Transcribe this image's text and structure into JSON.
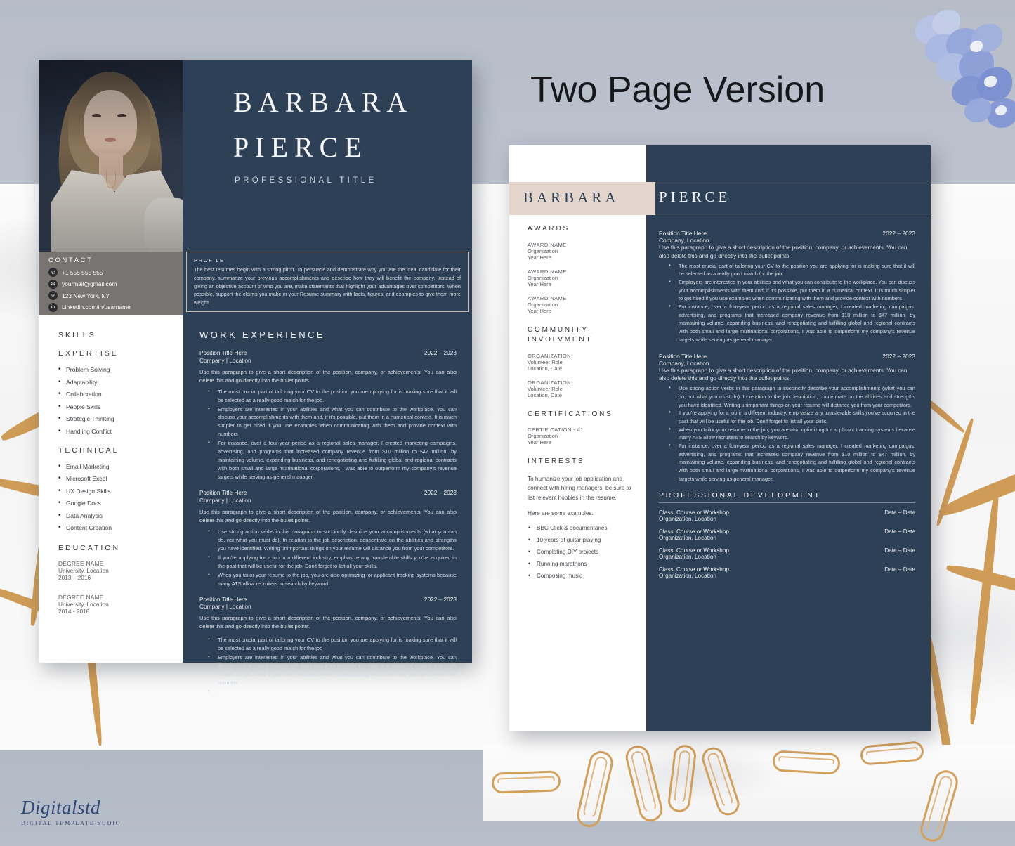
{
  "mockup": {
    "headline": "Two Page Version",
    "brand_name": "Digitalstd",
    "brand_tagline": "DIGITAL TEMPLATE SUDIO",
    "accent_navy": "#2e4055",
    "accent_beige": "#e3d5cb",
    "accent_gold": "#cf9c58"
  },
  "page1": {
    "name_first": "BARBARA",
    "name_last": "PIERCE",
    "professional_title": "PROFESSIONAL TITLE",
    "contact": {
      "heading": "CONTACT",
      "items": [
        {
          "icon": "phone-icon",
          "text": "+1 555 555 555"
        },
        {
          "icon": "envelope-icon",
          "text": "yourmail@gmail.com"
        },
        {
          "icon": "location-pin-icon",
          "text": "123 New York, NY"
        },
        {
          "icon": "linkedin-icon",
          "text": "Linkedin.com/in/usarname"
        }
      ]
    },
    "profile": {
      "heading": "PROFILE",
      "body": "The best resumes begin with a strong pitch. To persuade and demonstrate why you are the ideal candidate for their company, summarize your previous accomplishments and describe how they will benefit the company. Instead of giving an objective account of who you are, make statements that highlight your advantages over competitors. When possible, support the claims you make in your Resume summary with facts, figures, and examples to give them more weight."
    },
    "skills": {
      "heading": "SKILLS",
      "expertise_heading": "EXPERTISE",
      "expertise": [
        "Problem Solving",
        "Adaptability",
        "Collaboration",
        "People Skills",
        "Strategic Thinking",
        "Handling Conflict"
      ],
      "technical_heading": "TECHNICAL",
      "technical": [
        "Email Marketing",
        "Microsoft Excel",
        "UX Design Skills",
        "Google Docs",
        "Data Analysis",
        "Content Creation"
      ]
    },
    "education": {
      "heading": "EDUCATION",
      "entries": [
        {
          "degree": "DEGREE NAME",
          "school": "University, Location",
          "years": "2013 – 2016"
        },
        {
          "degree": "DEGREE NAME",
          "school": "University, Location",
          "years": "2014 - 2018"
        }
      ]
    },
    "work_experience": {
      "heading": "WORK EXPERIENCE",
      "jobs": [
        {
          "title": "Position Title Here",
          "date": "2022 – 2023",
          "company": "Company | Location",
          "description": "Use this paragraph to give a short description of the position, company, or achievements. You can also delete this and go directly into the bullet points.",
          "bullets": [
            "The most crucial part of tailoring your CV to the position you are applying for is making sure that it will be selected as a really good match for the job.",
            "Employers are interested in your abilities and what you can contribute to the workplace. You can discuss your accomplishments with them and, if it's possible, put them in a numerical context. It is much simpler to get hired if you use examples when communicating with them and provide context with numbers",
            "For instance, over a four-year period as a regional sales manager, I created marketing campaigns, advertising, and programs that increased company revenue from $10 million to $47 million. by maintaining volume, expanding business, and renegotiating and fulfilling global and regional contracts with both small and large multinational corporations, I was able to outperform my company's revenue targets while serving as general manager."
          ]
        },
        {
          "title": "Position Title Here",
          "date": "2022 – 2023",
          "company": "Company | Location",
          "description": "Use this paragraph to give a short description of the position, company, or achievements. You can also delete this and go directly into the bullet points.",
          "bullets": [
            "Use strong action verbs in this paragraph to succinctly describe your accomplishments (what you can do, not what you must do). In relation to the job description, concentrate on the abilities and strengths you have identified. Writing unimportant things on your resume will distance you from your competitors.",
            "If you're applying for a job in a different industry, emphasize any transferable skills you've acquired in the past that will be useful for the job. Don't forget to list all your skills.",
            "When you tailor your resume to the job, you are also optimizing for applicant tracking systems because many ATS allow recruiters to search by keyword."
          ]
        },
        {
          "title": "Position Title Here",
          "date": "2022 – 2023",
          "company": "Company | Location",
          "description": "Use this paragraph to give a short description of the position, company, or achievements. You can also delete this and go directly into the bullet points.",
          "bullets": [
            "The most crucial part of tailoring your CV to the position you are applying for is making sure that it will be selected as a really good match for the job",
            "Employers are interested in your abilities and what you can contribute to the workplace. You can discuss your accomplishments with them and, if it's possible, put them in a numerical context. It is much simpler to get hired if you use examples when communicating with them and provide context with numbers",
            "."
          ]
        }
      ]
    }
  },
  "page2": {
    "name_first": "BARBARA",
    "name_last": "PIERCE",
    "awards": {
      "heading": "AWARDS",
      "entries": [
        {
          "name": "AWARD NAME",
          "org": "Organization",
          "year": "Year Here"
        },
        {
          "name": "AWARD NAME",
          "org": "Organization",
          "year": "Year Here"
        },
        {
          "name": "AWARD NAME",
          "org": "Organization",
          "year": "Year Here"
        }
      ]
    },
    "community": {
      "heading": "COMMUNITY INVOLVMENT",
      "entries": [
        {
          "name": "ORGANIZATION",
          "org": "Volunteer Role",
          "year": "Location, Date"
        },
        {
          "name": "ORGANIZATION",
          "org": "Volunteer Role",
          "year": "Location, Date"
        }
      ]
    },
    "certifications": {
      "heading": "CERTIFICATIONS",
      "entries": [
        {
          "name": "CERTIFICATION - #1",
          "org": "Organization",
          "year": "Year Here"
        }
      ]
    },
    "interests": {
      "heading": "INTERESTS",
      "intro": "To humanize your job application and connect with hiring managers, be sure to list relevant hobbies in the resume.",
      "examples_label": "Here are some examples:",
      "items": [
        "BBC Click & documentaries",
        "10 years of guitar playing",
        "Completing DIY projects",
        "Running marathons",
        "Composing music"
      ]
    },
    "jobs": [
      {
        "title": "Position Title Here",
        "date": "2022 – 2023",
        "company": "Company, Location",
        "description": "Use this paragraph to give a short description of the position, company, or achievements. You can also delete this and go directly into the bullet points.",
        "bullets": [
          "The most crucial part of tailoring your CV to the position you are applying for is making sure that it will be selected as a really good match for the job.",
          "Employers are interested in your abilities and what you can contribute to the workplace. You can discuss your accomplishments with them and, if it's possible, put them in a numerical context. It is much simpler to get hired if you use examples when communicating with them and provide context with numbers",
          "For instance, over a four-year period as a regional sales manager, I created marketing campaigns, advertising, and programs that increased company revenue from $10 million to $47 million. by maintaining volume, expanding business, and renegotiating and fulfilling global and regional contracts with both small and large multinational corporations, I was able to outperform my company's revenue targets while serving as general manager."
        ]
      },
      {
        "title": "Position Title Here",
        "date": "2022 – 2023",
        "company": "Company, Location",
        "description": "Use this paragraph to give a short description of the position, company, or achievements. You can also delete this and go directly into the bullet points.",
        "bullets": [
          "Use strong action verbs in this paragraph to succinctly describe your accomplishments (what you can do, not what you must do). In relation to the job description, concentrate on the abilities and strengths you have identified. Writing unimportant things on your resume will distance you from your competitors.",
          "If you're applying for a job in a different industry, emphasize any transferable skills you've acquired in the past that will be useful for the job. Don't forget to list all your skills.",
          "When you tailor your resume to the job, you are also optimizing for applicant tracking systems because many ATS allow recruiters to search by keyword.",
          "For instance, over a four-year period as a regional sales manager, I created marketing campaigns, advertising, and programs that increased company revenue from $10 million to $47 million. by maintaining volume, expanding business, and renegotiating and fulfilling global and regional contracts with both small and large multinational corporations, I was able to outperform my company's revenue targets while serving as general manager."
        ]
      }
    ],
    "professional_development": {
      "heading": "PROFESSIONAL DEVELOPMENT",
      "rows": [
        {
          "course": "Class, Course or Workshop",
          "org": "Organization, Location",
          "date": "Date – Date"
        },
        {
          "course": "Class, Course or Workshop",
          "org": "Organization, Location",
          "date": "Date – Date"
        },
        {
          "course": "Class, Course or Workshop",
          "org": "Organization, Location",
          "date": "Date – Date"
        },
        {
          "course": "Class, Course or Workshop",
          "org": "Organization, Location",
          "date": "Date – Date"
        }
      ]
    }
  }
}
